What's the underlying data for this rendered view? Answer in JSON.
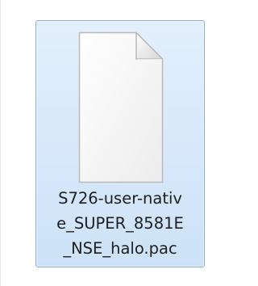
{
  "file": {
    "icon": "blank-document-icon",
    "name_lines": [
      "S726-user-nativ",
      "e_SUPER_8581E",
      "_NSE_halo.pac"
    ],
    "selected": true
  },
  "colors": {
    "selection_border": "#84acdd",
    "selection_fill_top": "#e3effc",
    "selection_fill_bottom": "#cde2f8"
  }
}
